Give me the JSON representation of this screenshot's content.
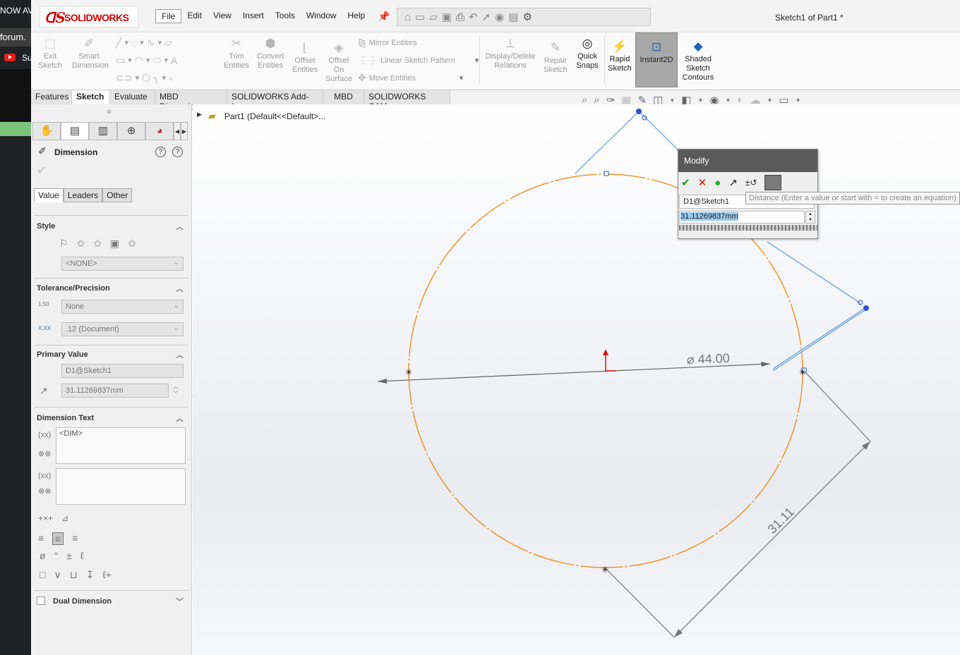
{
  "browser": {
    "tab_text_1": "NOW AV",
    "tab_text_2": "forum.",
    "tab_text_3": "Su"
  },
  "app": {
    "logo_text": "SOLIDWORKS",
    "doc_title": "Sketch1 of Part1 *",
    "menu": [
      "File",
      "Edit",
      "View",
      "Insert",
      "Tools",
      "Window",
      "Help"
    ]
  },
  "ribbon": {
    "exit_sketch": "Exit Sketch",
    "smart_dimension": "Smart Dimension",
    "trim_entities": "Trim Entities",
    "convert_entities": "Convert Entities",
    "offset_entities": "Offset Entities",
    "offset_on_surface": "Offset On Surface",
    "mirror_entities": "Mirror Entities",
    "linear_sketch_pattern": "Linear Sketch Pattern",
    "move_entities": "Move Entities",
    "display_delete_relations": "Display/Delete Relations",
    "repair_sketch": "Repair Sketch",
    "quick_snaps": "Quick Snaps",
    "rapid_sketch": "Rapid Sketch",
    "instant2d": "Instant2D",
    "shaded_sketch_contours": "Shaded Sketch Contours"
  },
  "tabs": [
    "Features",
    "Sketch",
    "Evaluate",
    "MBD Dimensions",
    "SOLIDWORKS Add-Ins",
    "MBD",
    "SOLIDWORKS CAM"
  ],
  "property_manager": {
    "title": "Dimension",
    "subtabs": [
      "Value",
      "Leaders",
      "Other"
    ],
    "style_label": "Style",
    "style_value": "<NONE>",
    "tolerance_label": "Tolerance/Precision",
    "tol_icon_text": "1.50",
    "tolerance_value": "None",
    "precision_icon_text": "X.XX",
    "precision_value": ".12 (Document)",
    "primary_value_label": "Primary Value",
    "primary_name": "D1@Sketch1",
    "primary_value": "31.11269837mm",
    "dimension_text_label": "Dimension Text",
    "dim_token": "<DIM>",
    "dual_dimension": "Dual Dimension"
  },
  "tree": {
    "part_label": "Part1  (Default<<Default>..."
  },
  "sketch": {
    "diameter_text": "⌀ 44.00",
    "linear_text": "31.11"
  },
  "modify_dialog": {
    "title": "Modify",
    "name": "D1@Sketch1",
    "value": "31.11269837mm",
    "tooltip": "Distance (Enter a value or start with = to create an equation)"
  }
}
